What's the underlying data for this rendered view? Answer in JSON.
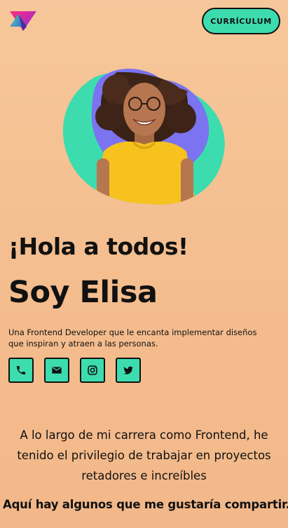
{
  "header": {
    "logo_icon": "triangle-logo-icon",
    "cv_button_label": "CURRÍCULUM"
  },
  "hero": {
    "image_description_icon": "profile-photo",
    "blob_colors": [
      "#3ddcae",
      "#7b73f0"
    ]
  },
  "intro": {
    "greeting": "¡Hola a todos!",
    "name": "Soy Elisa",
    "tagline": "Una Frontend Developer que le encanta implementar diseños que inspiran y atraen a las personas."
  },
  "social": [
    {
      "icon": "phone-icon"
    },
    {
      "icon": "email-icon"
    },
    {
      "icon": "instagram-icon"
    },
    {
      "icon": "twitter-icon"
    }
  ],
  "about": {
    "text": "A lo largo de mi carrera como Frontend, he tenido el privilegio de trabajar en proyectos retadores e increíbles",
    "share": "Aquí hay algunos que me gustaría compartir."
  },
  "colors": {
    "accent": "#3ddcae",
    "blob_secondary": "#7b73f0",
    "background_top": "#f6c79a",
    "text": "#111111"
  }
}
